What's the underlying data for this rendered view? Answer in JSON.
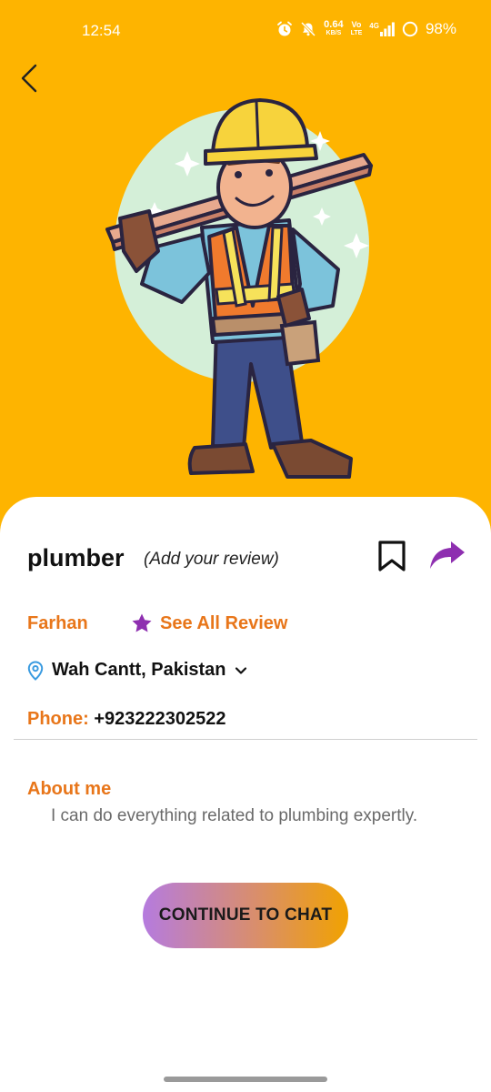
{
  "status_bar": {
    "time": "12:54",
    "net_speed_value": "0.64",
    "net_speed_unit": "KB/S",
    "volte": "Vo",
    "lte": "LTE",
    "network": "4G",
    "battery": "98%",
    "icons": [
      "alarm-icon",
      "mute-icon",
      "signal-icon",
      "battery-icon"
    ]
  },
  "header": {
    "back_icon": "chevron-left-icon",
    "illustration": "construction-worker-illustration"
  },
  "profile": {
    "title": "plumber",
    "review_link": "(Add your review)",
    "provider_name": "Farhan",
    "see_all_review": "See All Review",
    "location": "Wah Cantt, Pakistan",
    "phone_label": "Phone:",
    "phone_value": "+923222302522",
    "about_title": "About me",
    "about_text": "I can do everything related to plumbing expertly."
  },
  "actions": {
    "continue_label": "CONTINUE TO CHAT",
    "bookmark_icon": "bookmark-icon",
    "share_icon": "share-icon"
  },
  "colors": {
    "hero_background": "#FEB400",
    "accent_orange": "#E8761A",
    "accent_purple": "#8E2FB0",
    "cta_gradient_start": "#B57BDF",
    "cta_gradient_end": "#F1A200"
  }
}
